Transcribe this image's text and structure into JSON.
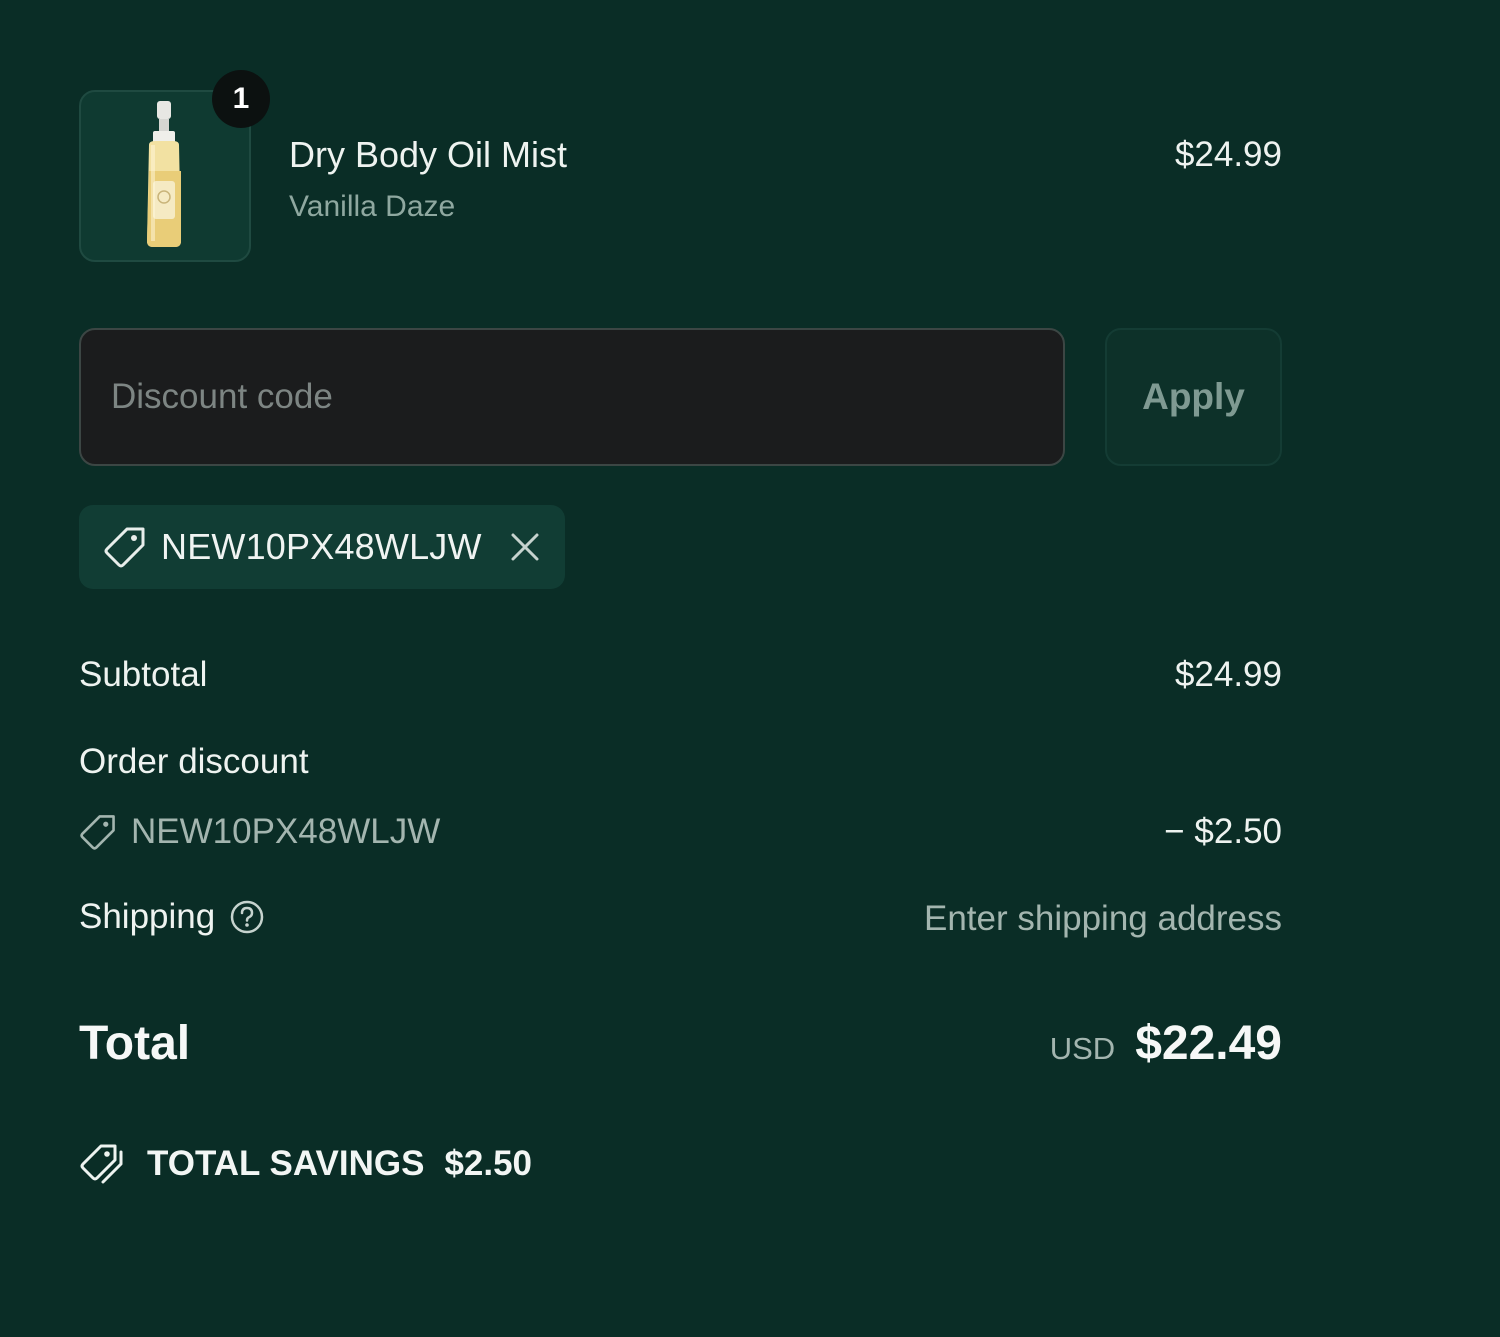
{
  "line_item": {
    "quantity": "1",
    "name": "Dry Body Oil Mist",
    "variant": "Vanilla Daze",
    "price": "$24.99",
    "image_icon": "spray-bottle-icon"
  },
  "discount_form": {
    "placeholder": "Discount code",
    "apply_label": "Apply"
  },
  "applied_code": {
    "code": "NEW10PX48WLJW",
    "icon": "tag-icon",
    "remove_icon": "close-icon"
  },
  "summary": {
    "subtotal_label": "Subtotal",
    "subtotal_value": "$24.99",
    "order_discount_label": "Order discount",
    "discount_code": "NEW10PX48WLJW",
    "discount_value": "− $2.50",
    "shipping_label": "Shipping",
    "shipping_value": "Enter shipping address",
    "total_label": "Total",
    "currency": "USD",
    "total_value": "$22.49"
  },
  "savings": {
    "label": "TOTAL SAVINGS",
    "amount": "$2.50",
    "icon": "tags-icon"
  },
  "colors": {
    "background": "#0a2d26",
    "input_background": "#1b1c1d",
    "chip_background": "#113d34",
    "muted_text": "#a3b5af"
  }
}
